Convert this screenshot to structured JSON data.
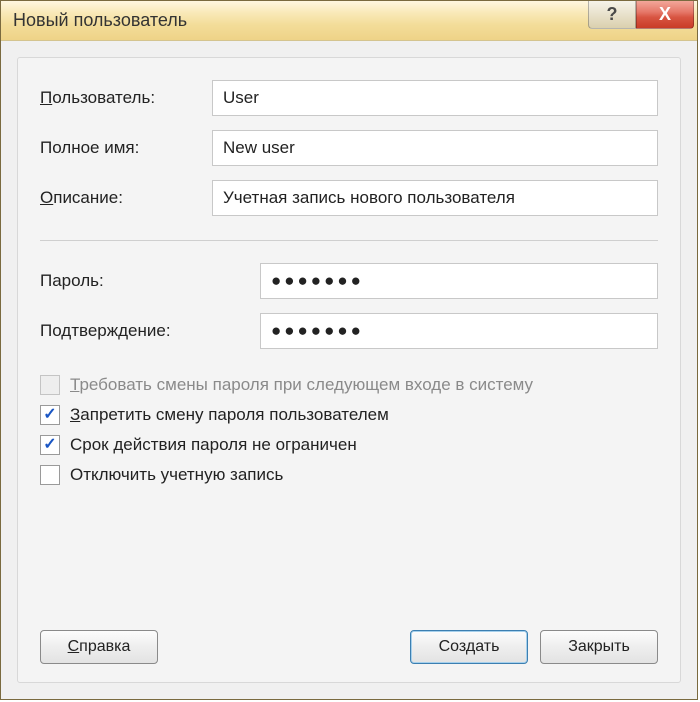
{
  "titlebar": {
    "title": "Новый пользователь",
    "help_symbol": "?",
    "close_symbol": "X"
  },
  "fields": {
    "username": {
      "label_u": "П",
      "label_rest": "ользователь:",
      "value": "User"
    },
    "fullname": {
      "label_u": "",
      "label_rest": "Полное имя:",
      "value": "New user"
    },
    "description": {
      "label_u": "О",
      "label_rest": "писание:",
      "value": "Учетная запись нового пользователя"
    },
    "password": {
      "label_u": "",
      "label_rest": "Пароль:",
      "value": "●●●●●●●"
    },
    "confirm": {
      "label_u": "",
      "label_rest": "Подтверждение:",
      "value": "●●●●●●●"
    }
  },
  "checks": {
    "must_change": {
      "u": "Т",
      "rest": "ребовать смены пароля при следующем входе в систему",
      "checked": false,
      "disabled": true
    },
    "cannot_change": {
      "u": "З",
      "rest": "апретить смену пароля пользователем",
      "checked": true,
      "disabled": false
    },
    "never_expires": {
      "u": "",
      "rest": "Срок действия пароля не ограничен",
      "checked": true,
      "disabled": false
    },
    "disabled_acct": {
      "u": "",
      "rest": "Отключить учетную запись",
      "checked": false,
      "disabled": false
    }
  },
  "buttons": {
    "help": {
      "u": "С",
      "rest": "правка"
    },
    "create": {
      "u": "",
      "rest": "Создать"
    },
    "close": {
      "u": "",
      "rest": "Закрыть"
    }
  }
}
